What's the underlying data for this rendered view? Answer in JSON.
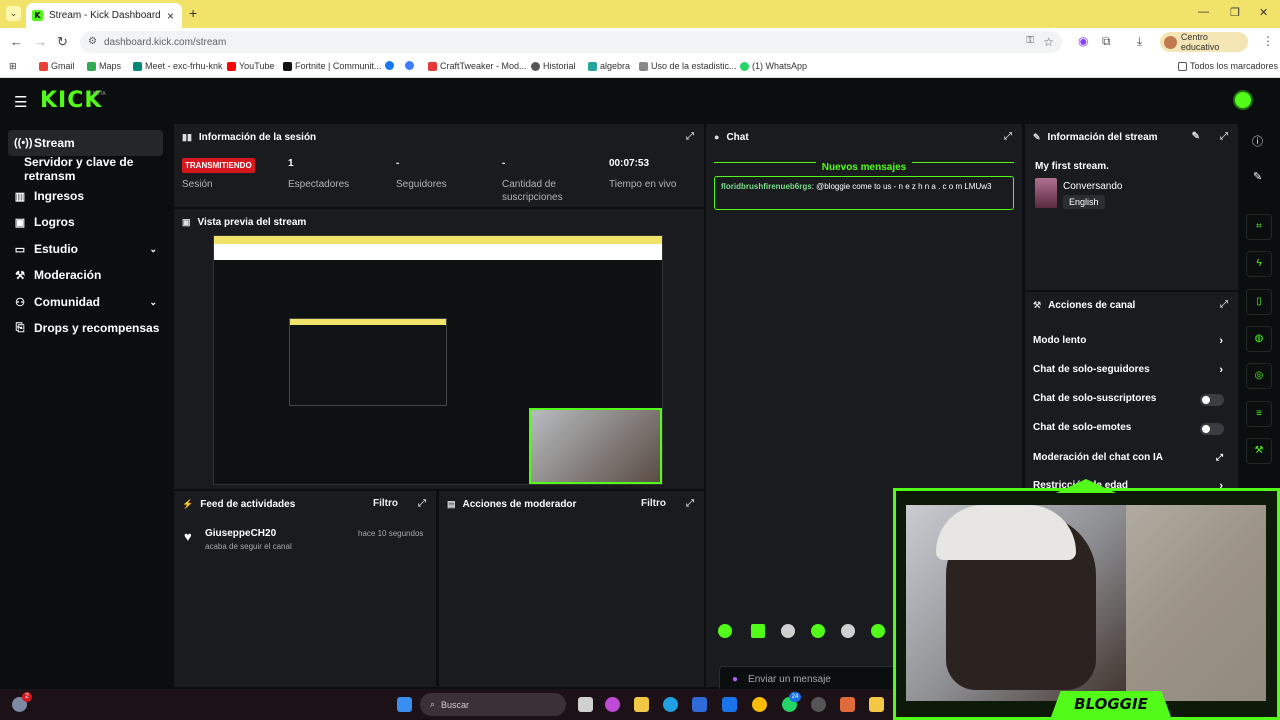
{
  "browser": {
    "tab_title": "Stream - Kick Dashboard",
    "url": "dashboard.kick.com/stream",
    "profile_label": "Centro educativo",
    "bookmarks": [
      {
        "label": "Gmail",
        "color": "#ea4335"
      },
      {
        "label": "Maps",
        "color": "#34a853"
      },
      {
        "label": "Meet - exc-frhu-knk",
        "color": "#00897b"
      },
      {
        "label": "YouTube",
        "color": "#ff0000"
      },
      {
        "label": "Fortnite | Communit...",
        "color": "#111111"
      },
      {
        "label": "",
        "color": "#1877f2"
      },
      {
        "label": "CraftTweaker - Mod...",
        "color": "#e53935"
      },
      {
        "label": "Historial",
        "color": "#555555"
      },
      {
        "label": "algebra",
        "color": "#26a69a"
      },
      {
        "label": "Uso de la estadistic...",
        "color": "#888888"
      },
      {
        "label": "(1) WhatsApp",
        "color": "#25d366"
      }
    ],
    "all_bookmarks": "Todos los marcadores"
  },
  "app": {
    "logo": "KICK",
    "beta": "BETA",
    "accent": "#53fc18"
  },
  "sidebar": {
    "items": [
      {
        "label": "Stream",
        "icon": "live-icon",
        "active": true
      },
      {
        "label": "Servidor y clave de retransm",
        "icon": "",
        "active": false
      },
      {
        "label": "Ingresos",
        "icon": "chart-icon",
        "active": false
      },
      {
        "label": "Logros",
        "icon": "trophy-icon",
        "active": false
      },
      {
        "label": "Estudio",
        "icon": "monitor-icon",
        "active": false
      },
      {
        "label": "Moderación",
        "icon": "wrench-icon",
        "active": false
      },
      {
        "label": "Comunidad",
        "icon": "users-icon",
        "active": false
      },
      {
        "label": "Drops y recompensas",
        "icon": "gift-icon",
        "active": false
      }
    ]
  },
  "session": {
    "title": "Información de la sesión",
    "live_badge": "TRANSMITIENDO",
    "session_label": "Sesión",
    "stats": [
      {
        "value": "1",
        "label": "Espectadores"
      },
      {
        "value": "-",
        "label": "Seguidores"
      },
      {
        "value": "-",
        "label": "Cantidad de suscripciones"
      },
      {
        "value": "00:07:53",
        "label": "Tiempo en vivo"
      }
    ]
  },
  "preview": {
    "title": "Vista previa del stream"
  },
  "feed": {
    "title": "Feed de actividades",
    "filter": "Filtro",
    "items": [
      {
        "user": "GiuseppeCH20",
        "action": "acaba de seguir el canal",
        "time": "hace 10 segundos"
      }
    ]
  },
  "mod_actions": {
    "title": "Acciones de moderador",
    "filter": "Filtro"
  },
  "chat": {
    "title": "Chat",
    "new_messages": "Nuevos mensajes",
    "messages": [
      {
        "user": "floridbrushfirenueb6rgs",
        "text": ": @bloggie come to us - n e z h n a . c o m LMUw3"
      }
    ],
    "input_placeholder": "Enviar un mensaje"
  },
  "stream_info": {
    "title": "Información del stream",
    "stream_title": "My first stream.",
    "category": "Conversando",
    "language": "English"
  },
  "channel_actions": {
    "title": "Acciones de canal",
    "rows": [
      {
        "label": "Modo lento",
        "control": "chevron"
      },
      {
        "label": "Chat de solo-seguidores",
        "control": "chevron"
      },
      {
        "label": "Chat de solo-suscriptores",
        "control": "toggle"
      },
      {
        "label": "Chat de solo-emotes",
        "control": "toggle"
      },
      {
        "label": "Moderación del chat con IA",
        "control": "external"
      },
      {
        "label": "Restricción de edad",
        "control": "chevron"
      }
    ]
  },
  "webcam": {
    "name": "BLOGGIE"
  },
  "taskbar": {
    "search_placeholder": "Buscar",
    "notif_badge": "2",
    "whatsapp_badge": "24"
  }
}
